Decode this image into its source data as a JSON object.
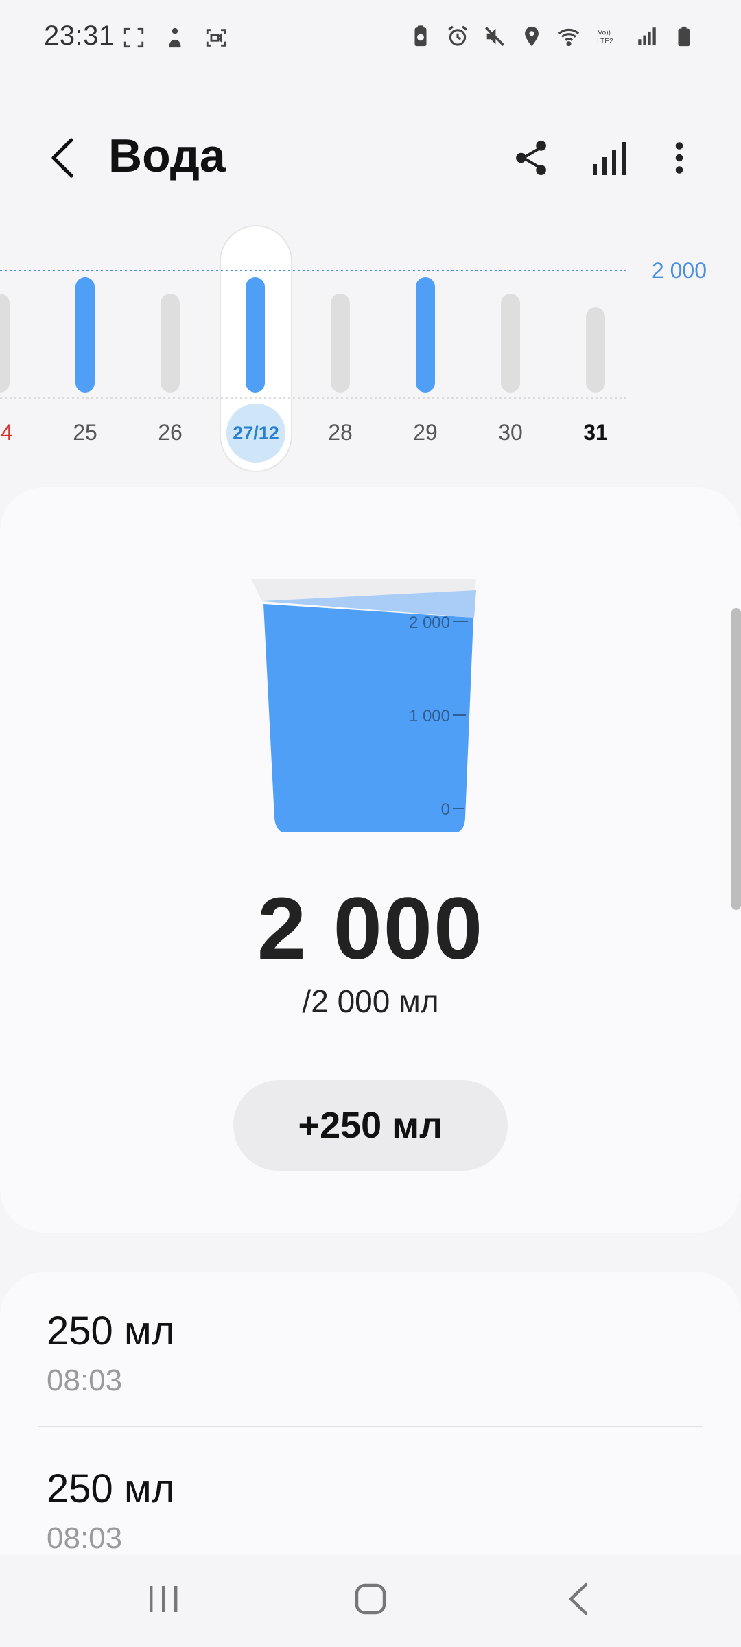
{
  "status_bar": {
    "time": "23:31",
    "left_icons": [
      "screenshot-icon",
      "accessibility-icon",
      "screen-record-icon"
    ],
    "right_icons": [
      "battery-saver-icon",
      "alarm-icon",
      "mute-icon",
      "location-icon",
      "wifi-icon",
      "volte-icon",
      "signal-icon",
      "battery-icon"
    ],
    "volte_text": "Vo)) LTE2"
  },
  "app_bar": {
    "title": "Вода",
    "back_icon": "chevron-left-icon",
    "share_icon": "share-icon",
    "stats_icon": "bar-chart-icon",
    "more_icon": "more-vertical-icon"
  },
  "week_chart": {
    "goal_label": "2 000",
    "days": [
      {
        "label": "4",
        "value": 0,
        "goal_met": false
      },
      {
        "label": "25",
        "value": 2000,
        "goal_met": true
      },
      {
        "label": "26",
        "value": 0,
        "goal_met": false
      },
      {
        "label": "27/12",
        "value": 2000,
        "goal_met": true,
        "selected": true
      },
      {
        "label": "28",
        "value": 0,
        "goal_met": false
      },
      {
        "label": "29",
        "value": 2000,
        "goal_met": true
      },
      {
        "label": "30",
        "value": 0,
        "goal_met": false
      },
      {
        "label": "31",
        "value": 0,
        "goal_met": false,
        "today": true
      }
    ],
    "colors": {
      "met": "#4f9ff7",
      "unmet": "#dedede",
      "goal_line": "#4a90e2"
    }
  },
  "summary": {
    "cup_ticks": [
      "2 000",
      "1 000",
      "0"
    ],
    "cup_fill_fraction": 1.0,
    "consumed": "2 000",
    "goal": "/2 000 мл",
    "add_button": "+250 мл",
    "colors": {
      "water": "#4f9ff7"
    }
  },
  "entries": [
    {
      "amount": "250 мл",
      "time": "08:03"
    },
    {
      "amount": "250 мл",
      "time": "08:03"
    }
  ],
  "nav_bar": {
    "recents_icon": "recents-icon",
    "home_icon": "home-icon",
    "back_icon": "back-icon"
  }
}
